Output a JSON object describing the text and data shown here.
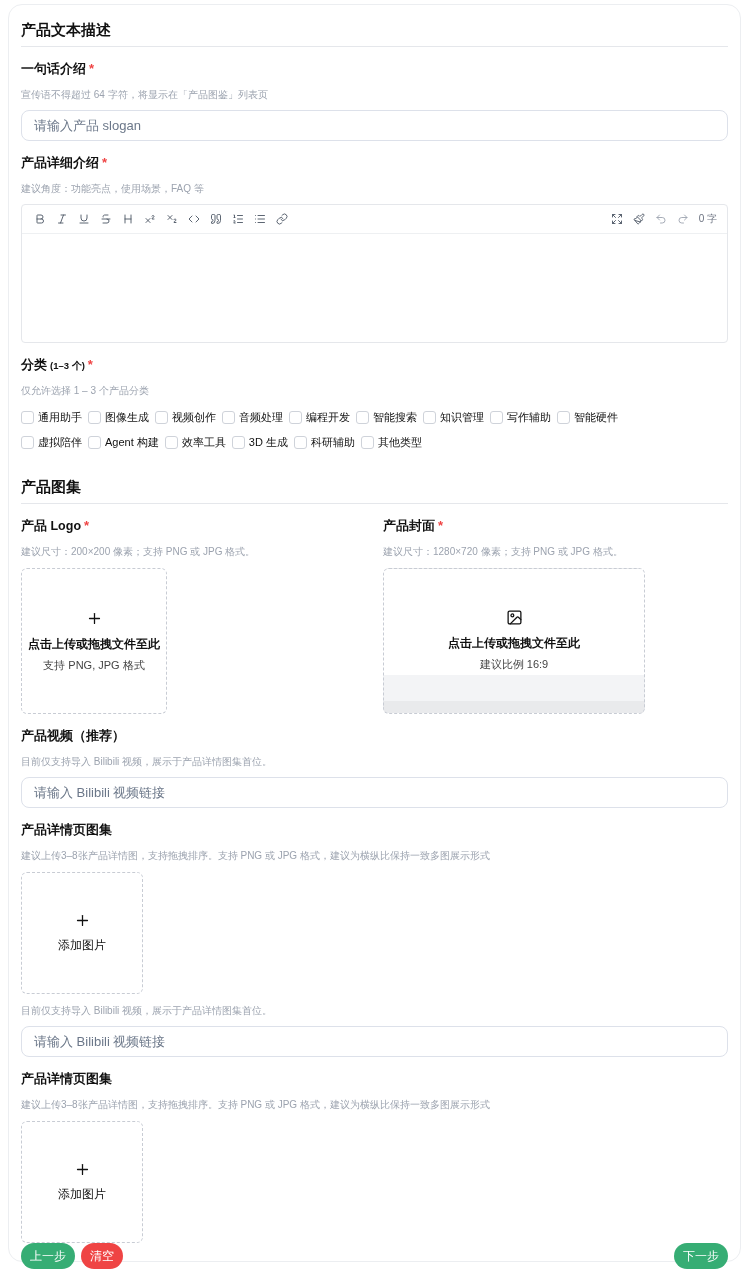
{
  "sections": [
    {
      "title": "产品文本描述",
      "fields": [
        {
          "kind": "text",
          "label": "一句话介绍",
          "required": "*",
          "hint": "宣传语不得超过 64 字符，将显示在「产品图鉴」列表页",
          "placeholder": "请输入产品 slogan"
        },
        {
          "kind": "editor",
          "label": "产品详细介绍",
          "required": "*",
          "hint": "建议角度：功能亮点，使用场景，FAQ 等",
          "counter": "0 字"
        },
        {
          "kind": "checkboxes",
          "label": "分类",
          "note": "(1–3 个)",
          "required": "*",
          "hint": "仅允许选择 1 – 3 个产品分类",
          "options": [
            {
              "label": "通用助手",
              "checked": false
            },
            {
              "label": "图像生成",
              "checked": false
            },
            {
              "label": "视频创作",
              "checked": false
            },
            {
              "label": "音频处理",
              "checked": false
            },
            {
              "label": "编程开发",
              "checked": false
            },
            {
              "label": "智能搜索",
              "checked": false
            },
            {
              "label": "知识管理",
              "checked": false
            },
            {
              "label": "写作辅助",
              "checked": false
            },
            {
              "label": "智能硬件",
              "checked": false
            },
            {
              "label": "虚拟陪伴",
              "checked": false
            },
            {
              "label": "Agent 构建",
              "checked": false
            },
            {
              "label": "效率工具",
              "checked": false
            },
            {
              "label": "3D 生成",
              "checked": false
            },
            {
              "label": "科研辅助",
              "checked": false
            },
            {
              "label": "其他类型",
              "checked": false
            }
          ]
        }
      ]
    },
    {
      "title": "产品图集",
      "fields": [
        {
          "kind": "uploads",
          "items": [
            {
              "kind": "square",
              "label": "产品 Logo",
              "required": "*",
              "hint": "建议尺寸：200×200 像素；支持 PNG 或 JPG 格式。",
              "title": "点击上传或拖拽文件至此",
              "subtitle": "支持 PNG, JPG 格式"
            },
            {
              "kind": "wide",
              "label": "产品封面",
              "required": "*",
              "hint": "建议尺寸：1280×720 像素；支持 PNG 或 JPG 格式。",
              "title": "点击上传或拖拽文件至此",
              "subtitle": "建议比例 16:9"
            }
          ]
        },
        {
          "kind": "text",
          "label": "产品视频（推荐）",
          "hint": "目前仅支持导入 Bilibili 视频，展示于产品详情图集首位。",
          "placeholder": "请输入 Bilibili 视频链接"
        },
        {
          "kind": "gallery",
          "label": "产品详情页图集",
          "hint": "建议上传3–8张产品详情图，支持拖拽排序。支持 PNG 或 JPG 格式，建议为横纵比保持一致多图展示形式",
          "tile": "添加图片"
        },
        {
          "kind": "text",
          "hint": "目前仅支持导入 Bilibili 视频，展示于产品详情图集首位。",
          "placeholder": "请输入 Bilibili 视频链接"
        },
        {
          "kind": "gallery",
          "label": "产品详情页图集",
          "hint": "建议上传3–8张产品详情图，支持拖拽排序。支持 PNG 或 JPG 格式，建议为横纵比保持一致多图展示形式",
          "tile": "添加图片"
        }
      ]
    }
  ],
  "buttons": {
    "left": [
      {
        "label": "上一步",
        "kind": "primary"
      },
      {
        "label": "清空",
        "kind": "danger"
      }
    ],
    "right": [
      {
        "label": "下一步",
        "kind": "primary"
      }
    ]
  }
}
